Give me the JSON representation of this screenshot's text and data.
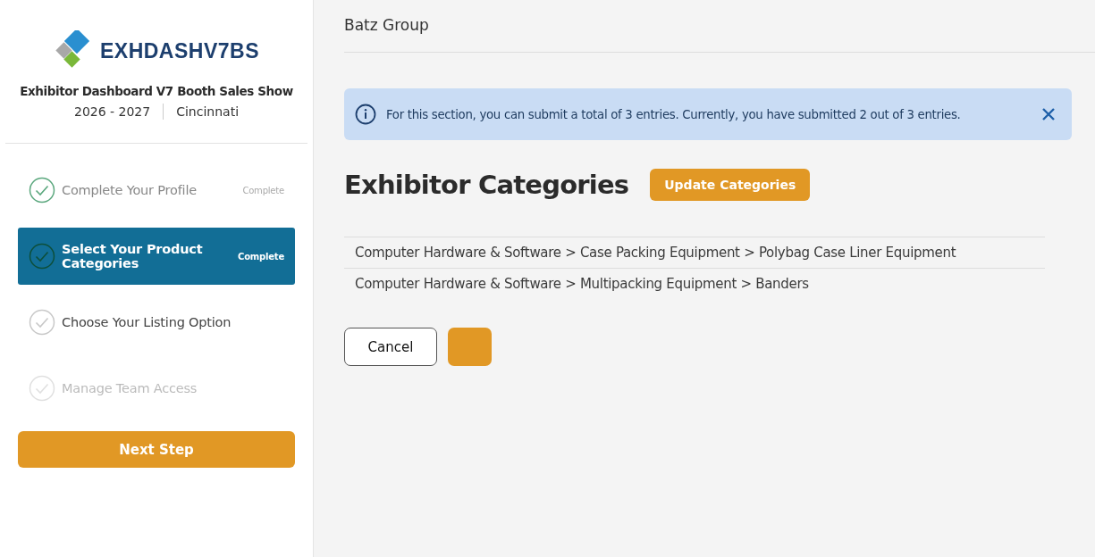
{
  "sidebar": {
    "logo_text": "EXHDASHV7BS",
    "show_title": "Exhibitor Dashboard V7 Booth Sales Show",
    "years": "2026 - 2027",
    "city": "Cincinnati",
    "steps": [
      {
        "label": "Complete Your Profile",
        "status": "Complete",
        "kind": "complete",
        "selected": false
      },
      {
        "label": "Select Your Product Categories",
        "status": "Complete",
        "kind": "complete",
        "selected": true
      },
      {
        "label": "Choose Your Listing Option",
        "kind": "pending",
        "selected": false
      },
      {
        "label": "Manage Team Access",
        "kind": "disabled",
        "selected": false
      }
    ],
    "next_button": "Next Step"
  },
  "main": {
    "company": "Batz Group",
    "alert": {
      "text": "For this section, you can submit a total of 3 entries. Currently, you have submitted 2 out of 3 entries."
    },
    "heading": "Exhibitor Categories",
    "update_button": "Update Categories",
    "categories": [
      "Computer Hardware & Software > Case Packing Equipment > Polybag Case Liner Equipment",
      "Computer Hardware & Software > Multipacking Equipment > Banders"
    ],
    "cancel_button": "Cancel"
  }
}
